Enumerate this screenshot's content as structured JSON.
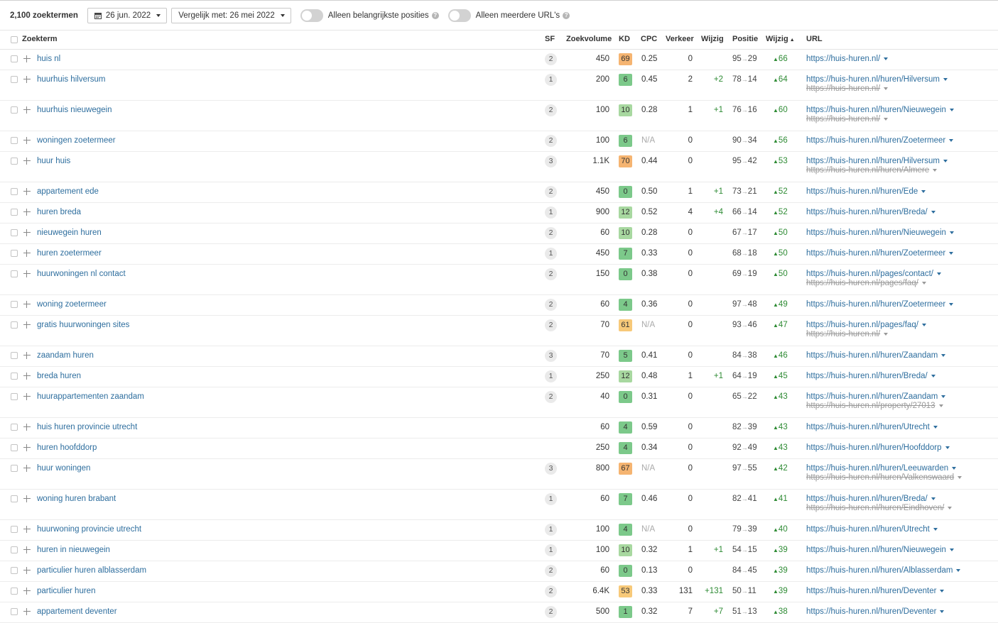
{
  "toolbar": {
    "count": "2,100 zoektermen",
    "date": "26 jun. 2022",
    "compare": "Vergelijk met: 26 mei 2022",
    "toggle1": "Alleen belangrijkste posities",
    "toggle2": "Alleen meerdere URL's",
    "help": "?"
  },
  "headers": {
    "keyword": "Zoekterm",
    "sf": "SF",
    "volume": "Zoekvolume",
    "kd": "KD",
    "cpc": "CPC",
    "traffic": "Verkeer",
    "diff": "Wijzig",
    "position": "Positie",
    "change": "Wijzig",
    "sort": "▲",
    "url": "URL"
  },
  "colors": {
    "kd_orange": "#f5b471",
    "kd_light_orange": "#f7c979",
    "kd_green": "#7cc98a",
    "kd_light_green": "#a8d8a0",
    "link": "#2e6e9e",
    "positive": "#2e8b34"
  },
  "rows": [
    {
      "kw": "huis nl",
      "sf": "2",
      "vol": "450",
      "kd": "69",
      "kdc": "#f5b471",
      "cpc": "0.25",
      "tr": "0",
      "diff": "",
      "p1": "95",
      "p2": "29",
      "chg": "66",
      "url": "https://huis-huren.nl/",
      "url2": ""
    },
    {
      "kw": "huurhuis hilversum",
      "sf": "1",
      "vol": "200",
      "kd": "6",
      "kdc": "#7cc98a",
      "cpc": "0.45",
      "tr": "2",
      "diff": "+2",
      "p1": "78",
      "p2": "14",
      "chg": "64",
      "url": "https://huis-huren.nl/huren/Hilversum",
      "url2": "https://huis-huren.nl/"
    },
    {
      "kw": "huurhuis nieuwegein",
      "sf": "2",
      "vol": "100",
      "kd": "10",
      "kdc": "#a8d8a0",
      "cpc": "0.28",
      "tr": "1",
      "diff": "+1",
      "p1": "76",
      "p2": "16",
      "chg": "60",
      "url": "https://huis-huren.nl/huren/Nieuwegein",
      "url2": "https://huis-huren.nl/"
    },
    {
      "kw": "woningen zoetermeer",
      "sf": "2",
      "vol": "100",
      "kd": "6",
      "kdc": "#7cc98a",
      "cpc": "N/A",
      "tr": "0",
      "diff": "",
      "p1": "90",
      "p2": "34",
      "chg": "56",
      "url": "https://huis-huren.nl/huren/Zoetermeer",
      "url2": ""
    },
    {
      "kw": "huur huis",
      "sf": "3",
      "vol": "1.1K",
      "kd": "70",
      "kdc": "#f5b471",
      "cpc": "0.44",
      "tr": "0",
      "diff": "",
      "p1": "95",
      "p2": "42",
      "chg": "53",
      "url": "https://huis-huren.nl/huren/Hilversum",
      "url2": "https://huis-huren.nl/huren/Almere"
    },
    {
      "kw": "appartement ede",
      "sf": "2",
      "vol": "450",
      "kd": "0",
      "kdc": "#7cc98a",
      "cpc": "0.50",
      "tr": "1",
      "diff": "+1",
      "p1": "73",
      "p2": "21",
      "chg": "52",
      "url": "https://huis-huren.nl/huren/Ede",
      "url2": ""
    },
    {
      "kw": "huren breda",
      "sf": "1",
      "vol": "900",
      "kd": "12",
      "kdc": "#a8d8a0",
      "cpc": "0.52",
      "tr": "4",
      "diff": "+4",
      "p1": "66",
      "p2": "14",
      "chg": "52",
      "url": "https://huis-huren.nl/huren/Breda/",
      "url2": ""
    },
    {
      "kw": "nieuwegein huren",
      "sf": "2",
      "vol": "60",
      "kd": "10",
      "kdc": "#a8d8a0",
      "cpc": "0.28",
      "tr": "0",
      "diff": "",
      "p1": "67",
      "p2": "17",
      "chg": "50",
      "url": "https://huis-huren.nl/huren/Nieuwegein",
      "url2": ""
    },
    {
      "kw": "huren zoetermeer",
      "sf": "1",
      "vol": "450",
      "kd": "7",
      "kdc": "#7cc98a",
      "cpc": "0.33",
      "tr": "0",
      "diff": "",
      "p1": "68",
      "p2": "18",
      "chg": "50",
      "url": "https://huis-huren.nl/huren/Zoetermeer",
      "url2": ""
    },
    {
      "kw": "huurwoningen nl contact",
      "sf": "2",
      "vol": "150",
      "kd": "0",
      "kdc": "#7cc98a",
      "cpc": "0.38",
      "tr": "0",
      "diff": "",
      "p1": "69",
      "p2": "19",
      "chg": "50",
      "url": "https://huis-huren.nl/pages/contact/",
      "url2": "https://huis-huren.nl/pages/faq/"
    },
    {
      "kw": "woning zoetermeer",
      "sf": "2",
      "vol": "60",
      "kd": "4",
      "kdc": "#7cc98a",
      "cpc": "0.36",
      "tr": "0",
      "diff": "",
      "p1": "97",
      "p2": "48",
      "chg": "49",
      "url": "https://huis-huren.nl/huren/Zoetermeer",
      "url2": ""
    },
    {
      "kw": "gratis huurwoningen sites",
      "sf": "2",
      "vol": "70",
      "kd": "61",
      "kdc": "#f7c979",
      "cpc": "N/A",
      "tr": "0",
      "diff": "",
      "p1": "93",
      "p2": "46",
      "chg": "47",
      "url": "https://huis-huren.nl/pages/faq/",
      "url2": "https://huis-huren.nl/"
    },
    {
      "kw": "zaandam huren",
      "sf": "3",
      "vol": "70",
      "kd": "5",
      "kdc": "#7cc98a",
      "cpc": "0.41",
      "tr": "0",
      "diff": "",
      "p1": "84",
      "p2": "38",
      "chg": "46",
      "url": "https://huis-huren.nl/huren/Zaandam",
      "url2": ""
    },
    {
      "kw": "breda huren",
      "sf": "1",
      "vol": "250",
      "kd": "12",
      "kdc": "#a8d8a0",
      "cpc": "0.48",
      "tr": "1",
      "diff": "+1",
      "p1": "64",
      "p2": "19",
      "chg": "45",
      "url": "https://huis-huren.nl/huren/Breda/",
      "url2": ""
    },
    {
      "kw": "huurappartementen zaandam",
      "sf": "2",
      "vol": "40",
      "kd": "0",
      "kdc": "#7cc98a",
      "cpc": "0.31",
      "tr": "0",
      "diff": "",
      "p1": "65",
      "p2": "22",
      "chg": "43",
      "url": "https://huis-huren.nl/huren/Zaandam",
      "url2": "https://huis-huren.nl/property/27013"
    },
    {
      "kw": "huis huren provincie utrecht",
      "sf": "",
      "vol": "60",
      "kd": "4",
      "kdc": "#7cc98a",
      "cpc": "0.59",
      "tr": "0",
      "diff": "",
      "p1": "82",
      "p2": "39",
      "chg": "43",
      "url": "https://huis-huren.nl/huren/Utrecht",
      "url2": ""
    },
    {
      "kw": "huren hoofddorp",
      "sf": "",
      "vol": "250",
      "kd": "4",
      "kdc": "#7cc98a",
      "cpc": "0.34",
      "tr": "0",
      "diff": "",
      "p1": "92",
      "p2": "49",
      "chg": "43",
      "url": "https://huis-huren.nl/huren/Hoofddorp",
      "url2": ""
    },
    {
      "kw": "huur woningen",
      "sf": "3",
      "vol": "800",
      "kd": "67",
      "kdc": "#f5b471",
      "cpc": "N/A",
      "tr": "0",
      "diff": "",
      "p1": "97",
      "p2": "55",
      "chg": "42",
      "url": "https://huis-huren.nl/huren/Leeuwarden",
      "url2": "https://huis-huren.nl/huren/Valkenswaard"
    },
    {
      "kw": "woning huren brabant",
      "sf": "1",
      "vol": "60",
      "kd": "7",
      "kdc": "#7cc98a",
      "cpc": "0.46",
      "tr": "0",
      "diff": "",
      "p1": "82",
      "p2": "41",
      "chg": "41",
      "url": "https://huis-huren.nl/huren/Breda/",
      "url2": "https://huis-huren.nl/huren/Eindhoven/"
    },
    {
      "kw": "huurwoning provincie utrecht",
      "sf": "1",
      "vol": "100",
      "kd": "4",
      "kdc": "#7cc98a",
      "cpc": "N/A",
      "tr": "0",
      "diff": "",
      "p1": "79",
      "p2": "39",
      "chg": "40",
      "url": "https://huis-huren.nl/huren/Utrecht",
      "url2": ""
    },
    {
      "kw": "huren in nieuwegein",
      "sf": "1",
      "vol": "100",
      "kd": "10",
      "kdc": "#a8d8a0",
      "cpc": "0.32",
      "tr": "1",
      "diff": "+1",
      "p1": "54",
      "p2": "15",
      "chg": "39",
      "url": "https://huis-huren.nl/huren/Nieuwegein",
      "url2": ""
    },
    {
      "kw": "particulier huren alblasserdam",
      "sf": "2",
      "vol": "60",
      "kd": "0",
      "kdc": "#7cc98a",
      "cpc": "0.13",
      "tr": "0",
      "diff": "",
      "p1": "84",
      "p2": "45",
      "chg": "39",
      "url": "https://huis-huren.nl/huren/Alblasserdam",
      "url2": ""
    },
    {
      "kw": "particulier huren",
      "sf": "2",
      "vol": "6.4K",
      "kd": "53",
      "kdc": "#f7c979",
      "cpc": "0.33",
      "tr": "131",
      "diff": "+131",
      "p1": "50",
      "p2": "11",
      "chg": "39",
      "url": "https://huis-huren.nl/huren/Deventer",
      "url2": ""
    },
    {
      "kw": "appartement deventer",
      "sf": "2",
      "vol": "500",
      "kd": "1",
      "kdc": "#7cc98a",
      "cpc": "0.32",
      "tr": "7",
      "diff": "+7",
      "p1": "51",
      "p2": "13",
      "chg": "38",
      "url": "https://huis-huren.nl/huren/Deventer",
      "url2": ""
    }
  ]
}
